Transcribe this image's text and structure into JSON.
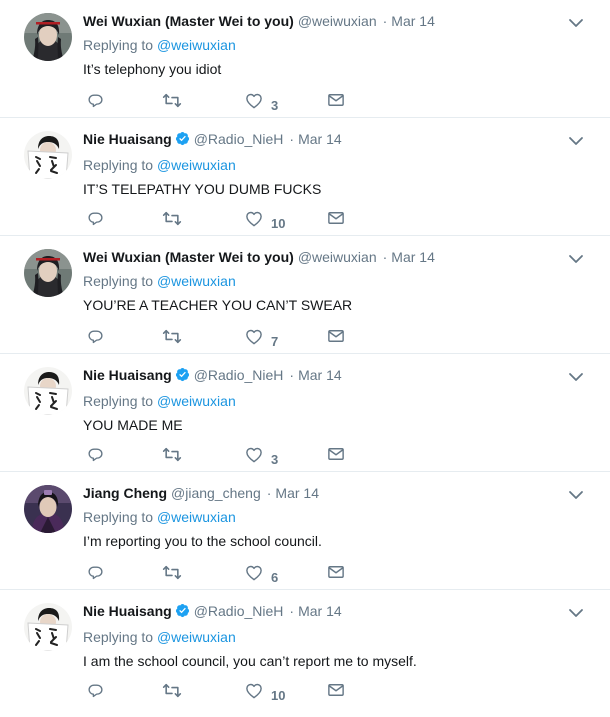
{
  "tweets": [
    {
      "name": "Wei Wuxian (Master Wei to you)",
      "handle": "@weiwuxian",
      "time": "Mar 14",
      "verified": false,
      "replying_label": "Replying to",
      "replying_to": "@weiwuxian",
      "text": "It’s telephony you idiot",
      "likes": "3",
      "avatar": "weiwuxian"
    },
    {
      "name": "Nie Huaisang",
      "handle": "@Radio_NieH",
      "time": "Mar 14",
      "verified": true,
      "replying_label": "Replying to",
      "replying_to": "@weiwuxian",
      "text": "IT’S TELEPATHY YOU DUMB FUCKS",
      "likes": "10",
      "avatar": "nie"
    },
    {
      "name": "Wei Wuxian (Master Wei to you)",
      "handle": "@weiwuxian",
      "time": "Mar 14",
      "verified": false,
      "replying_label": "Replying to",
      "replying_to": "@weiwuxian",
      "text": "YOU’RE A TEACHER YOU CAN’T SWEAR",
      "likes": "7",
      "avatar": "weiwuxian"
    },
    {
      "name": "Nie Huaisang",
      "handle": "@Radio_NieH",
      "time": "Mar 14",
      "verified": true,
      "replying_label": "Replying to",
      "replying_to": "@weiwuxian",
      "text": "YOU MADE ME",
      "likes": "3",
      "avatar": "nie"
    },
    {
      "name": "Jiang Cheng",
      "handle": "@jiang_cheng",
      "time": "Mar 14",
      "verified": false,
      "replying_label": "Replying to",
      "replying_to": "@weiwuxian",
      "text": "I’m reporting you to the school council.",
      "likes": "6",
      "avatar": "jiang"
    },
    {
      "name": "Nie Huaisang",
      "handle": "@Radio_NieH",
      "time": "Mar 14",
      "verified": true,
      "replying_label": "Replying to",
      "replying_to": "@weiwuxian",
      "text": "I am the school council, you can’t report me to myself.",
      "likes": "10",
      "avatar": "nie"
    }
  ],
  "colors": {
    "link": "#1b95e0",
    "muted": "#657786",
    "verified": "#1da1f2",
    "divider": "#e6ecf0"
  },
  "icons": [
    "reply-icon",
    "retweet-icon",
    "like-icon",
    "direct-message-icon",
    "chevron-down-icon",
    "verified-badge-icon"
  ]
}
